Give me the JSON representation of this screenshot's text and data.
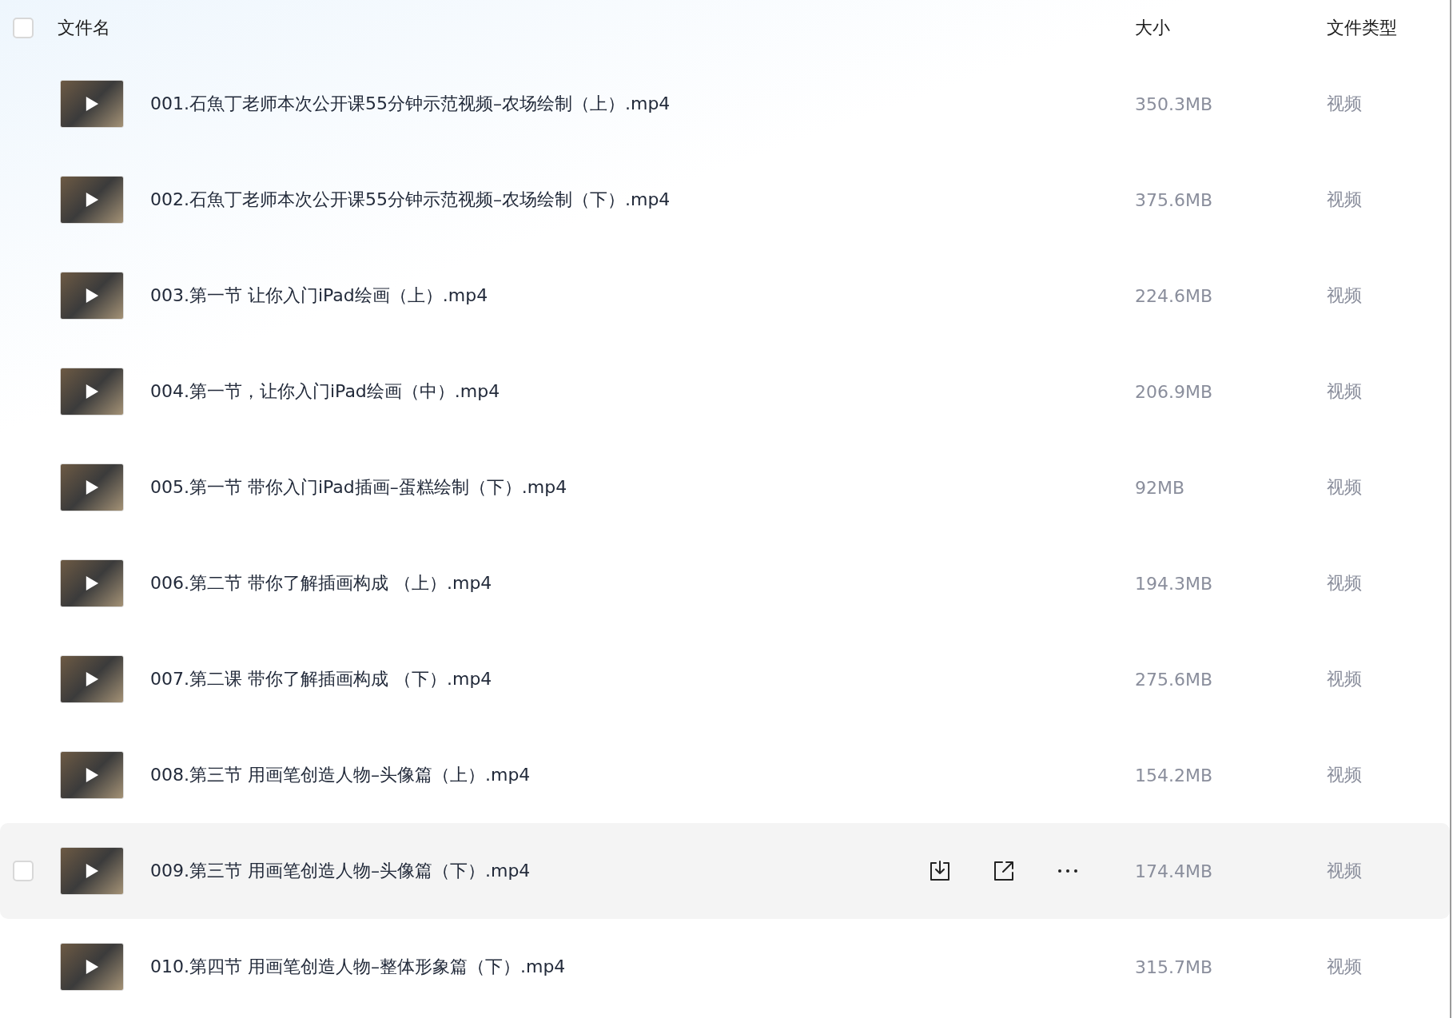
{
  "header": {
    "checked": false,
    "columns": [
      "文件名",
      "大小",
      "文件类型"
    ]
  },
  "rows": [
    {
      "name": "001.石魚丁老师本次公开课55分钟示范视频–农场绘制（上）.mp4",
      "size": "350.3MB",
      "type": "视频",
      "hovered": false,
      "checked": false
    },
    {
      "name": "002.石魚丁老师本次公开课55分钟示范视频–农场绘制（下）.mp4",
      "size": "375.6MB",
      "type": "视频",
      "hovered": false,
      "checked": false
    },
    {
      "name": "003.第一节 让你入门iPad绘画（上）.mp4",
      "size": "224.6MB",
      "type": "视频",
      "hovered": false,
      "checked": false
    },
    {
      "name": "004.第一节，让你入门iPad绘画（中）.mp4",
      "size": "206.9MB",
      "type": "视频",
      "hovered": false,
      "checked": false
    },
    {
      "name": "005.第一节 带你入门iPad插画–蛋糕绘制（下）.mp4",
      "size": "92MB",
      "type": "视频",
      "hovered": false,
      "checked": false
    },
    {
      "name": "006.第二节 带你了解插画构成 （上）.mp4",
      "size": "194.3MB",
      "type": "视频",
      "hovered": false,
      "checked": false
    },
    {
      "name": "007.第二课 带你了解插画构成 （下）.mp4",
      "size": "275.6MB",
      "type": "视频",
      "hovered": false,
      "checked": false
    },
    {
      "name": "008.第三节 用画笔创造人物–头像篇（上）.mp4",
      "size": "154.2MB",
      "type": "视频",
      "hovered": false,
      "checked": false
    },
    {
      "name": "009.第三节 用画笔创造人物–头像篇（下）.mp4",
      "size": "174.4MB",
      "type": "视频",
      "hovered": true,
      "checked": false
    },
    {
      "name": "010.第四节 用画笔创造人物–整体形象篇（下）.mp4",
      "size": "315.7MB",
      "type": "视频",
      "hovered": false,
      "checked": false
    }
  ]
}
